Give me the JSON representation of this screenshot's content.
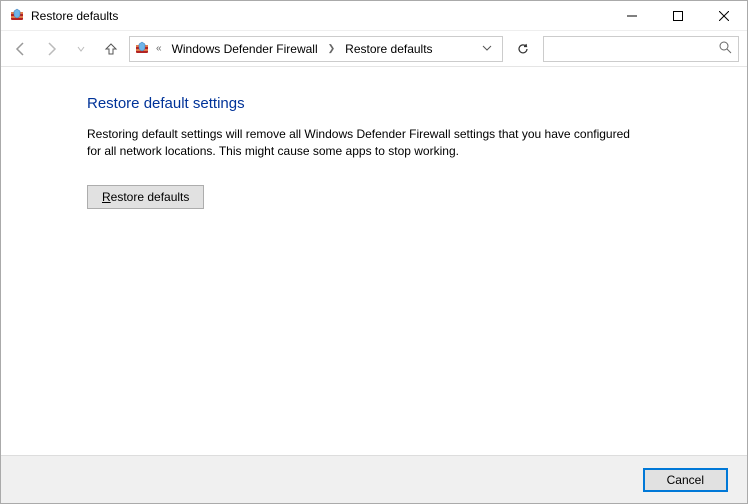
{
  "window": {
    "title": "Restore defaults"
  },
  "breadcrumb": {
    "seg1": "Windows Defender Firewall",
    "seg2": "Restore defaults"
  },
  "search": {
    "placeholder": ""
  },
  "main": {
    "heading": "Restore default settings",
    "description": "Restoring default settings will remove all Windows Defender Firewall settings that you have configured for all network locations. This might cause some apps to stop working.",
    "restore_prefix": "R",
    "restore_rest": "estore defaults"
  },
  "footer": {
    "cancel": "Cancel"
  }
}
